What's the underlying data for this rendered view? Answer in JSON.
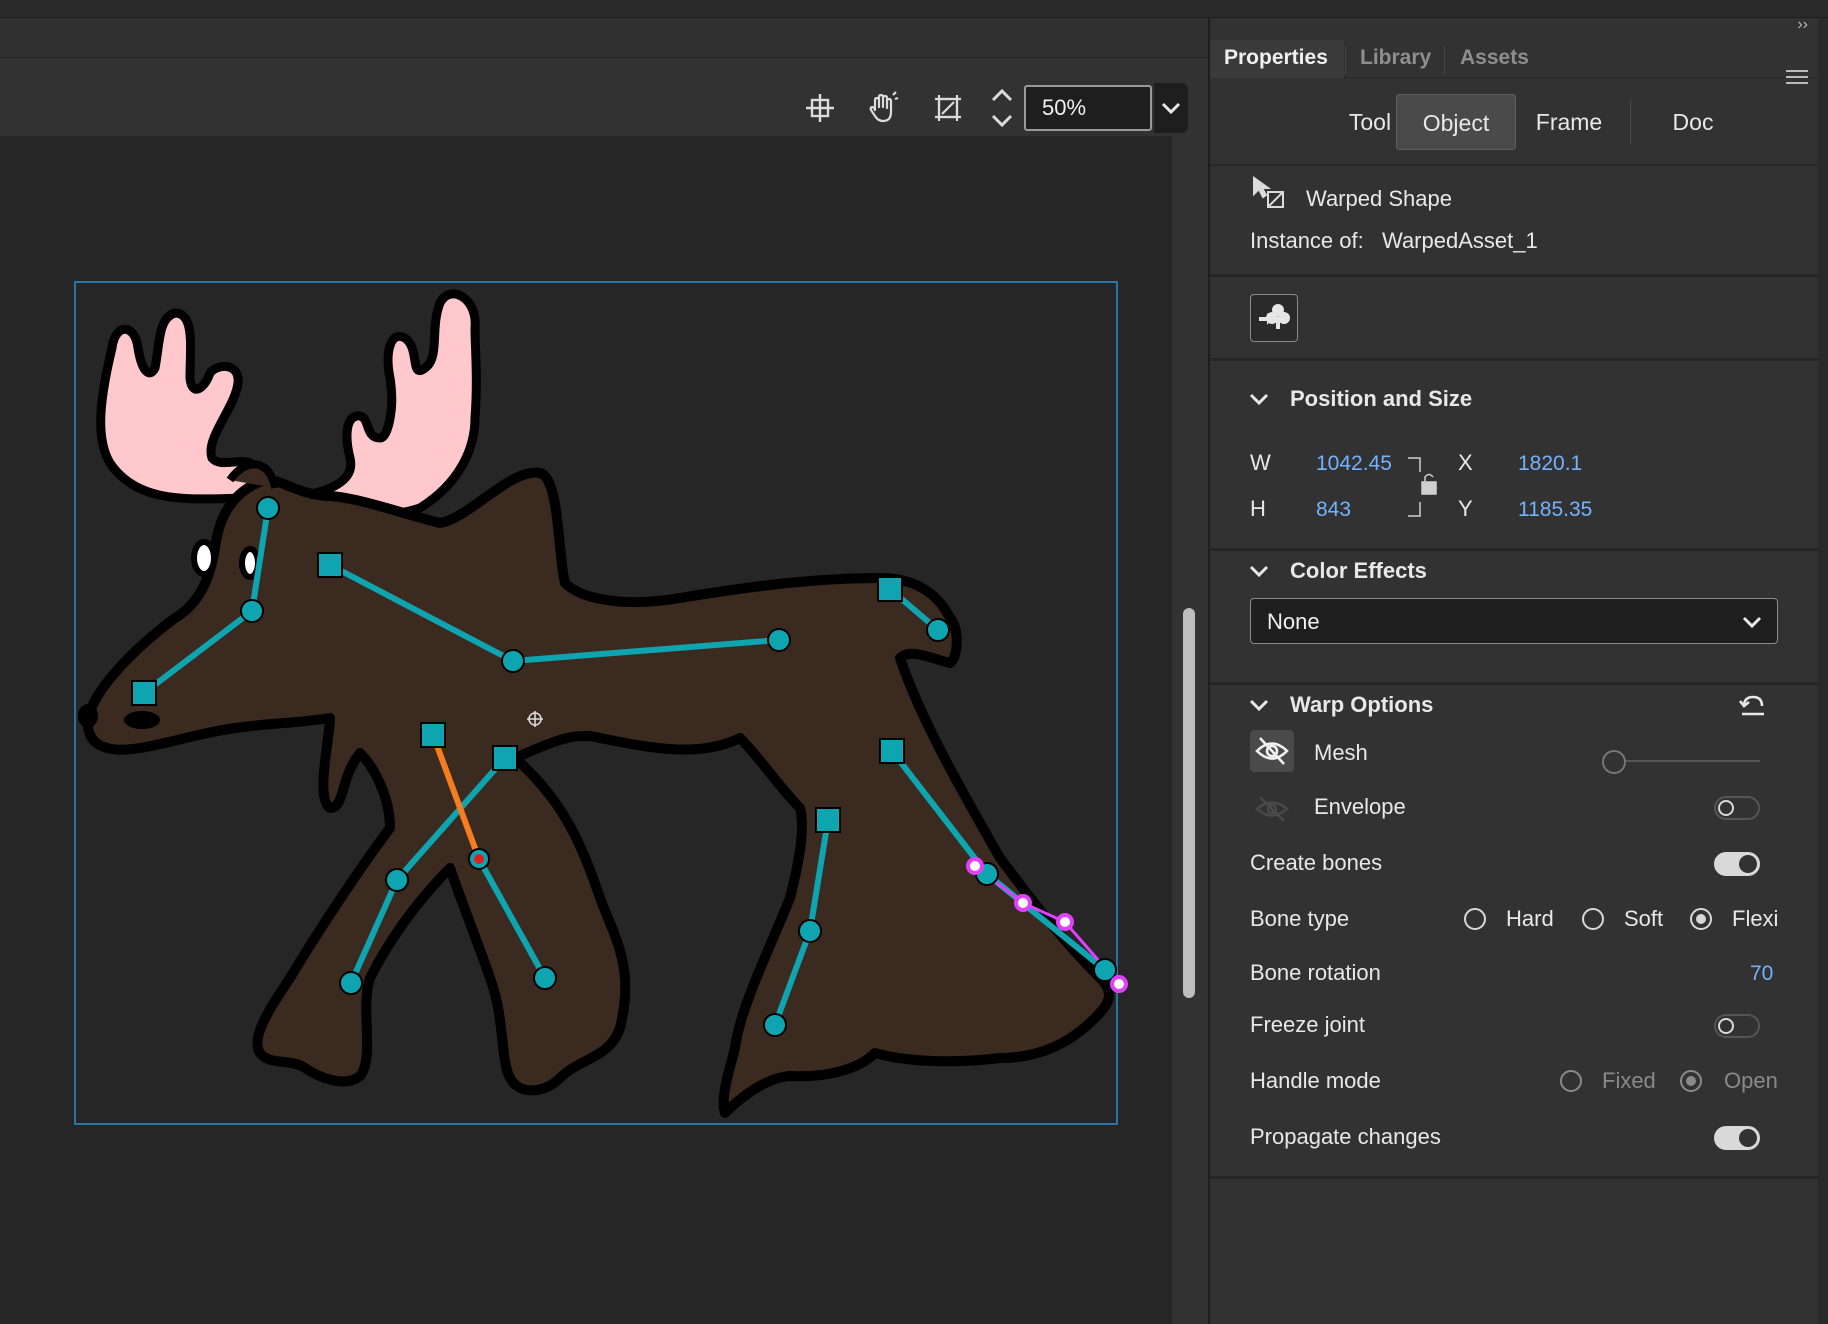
{
  "toolbar": {
    "zoom_value": "50%"
  },
  "panel": {
    "tabs": [
      {
        "label": "Properties",
        "active": true
      },
      {
        "label": "Library",
        "active": false
      },
      {
        "label": "Assets",
        "active": false
      }
    ],
    "subtabs": [
      {
        "label": "Tool"
      },
      {
        "label": "Object",
        "active": true
      },
      {
        "label": "Frame"
      },
      {
        "label": "Doc"
      }
    ],
    "object": {
      "type_label": "Warped Shape",
      "instance_label": "Instance of:",
      "instance_name": "WarpedAsset_1"
    },
    "position_size": {
      "title": "Position and Size",
      "w_label": "W",
      "w_value": "1042.45",
      "h_label": "H",
      "h_value": "843",
      "x_label": "X",
      "x_value": "1820.1",
      "y_label": "Y",
      "y_value": "1185.35"
    },
    "color_effects": {
      "title": "Color Effects",
      "selected": "None"
    },
    "warp_options": {
      "title": "Warp Options",
      "mesh_label": "Mesh",
      "envelope_label": "Envelope",
      "envelope_on": false,
      "create_bones_label": "Create bones",
      "create_bones_on": true,
      "bone_type_label": "Bone type",
      "bone_types": [
        {
          "label": "Hard",
          "checked": false
        },
        {
          "label": "Soft",
          "checked": false
        },
        {
          "label": "Flexi",
          "checked": true
        }
      ],
      "bone_rotation_label": "Bone rotation",
      "bone_rotation_value": "70",
      "freeze_joint_label": "Freeze joint",
      "freeze_joint_on": false,
      "handle_mode_label": "Handle mode",
      "handle_modes": [
        {
          "label": "Fixed",
          "checked": false
        },
        {
          "label": "Open",
          "checked": true
        }
      ],
      "propagate_label": "Propagate changes",
      "propagate_on": true
    }
  },
  "colors": {
    "bone": "#0ea5b0",
    "selected_bone": "#f57c20",
    "handle": "#e040fb",
    "moose_body": "#3a2a1f",
    "antler": "#ffc8cc",
    "selection_box": "#2d8ccf"
  },
  "icons": [
    "move-anchor-icon",
    "hand-icon",
    "clip-stage-icon",
    "chevron-up-icon",
    "chevron-down-icon",
    "warp-tool-icon",
    "club-symbol-icon",
    "link-lock-icon",
    "reset-icon",
    "eye-hidden-icon",
    "panel-menu-icon"
  ]
}
